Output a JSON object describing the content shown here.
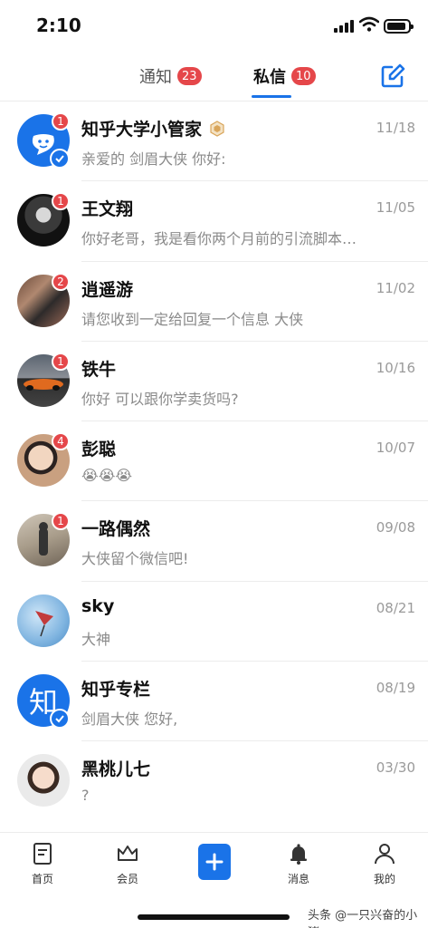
{
  "status_bar": {
    "time": "2:10"
  },
  "tabs": [
    {
      "label": "通知",
      "badge": "23",
      "active": false
    },
    {
      "label": "私信",
      "badge": "10",
      "active": true
    }
  ],
  "colors": {
    "accent": "#1a73e8",
    "badge_red": "#e5474a"
  },
  "messages": [
    {
      "name": "知乎大学小管家",
      "date": "11/18",
      "preview": "亲爱的 剑眉大侠 你好:",
      "unread": "1",
      "verified": true,
      "gold_badge": true,
      "avatar": "zhihu-smile-avatar"
    },
    {
      "name": "王文翔",
      "date": "11/05",
      "preview": "你好老哥，我是看你两个月前的引流脚本…",
      "unread": "1",
      "avatar": "photo-avatar"
    },
    {
      "name": "逍遥游",
      "date": "11/02",
      "preview": "请您收到一定给回复一个信息 大侠",
      "unread": "2",
      "avatar": "photo-avatar"
    },
    {
      "name": "铁牛",
      "date": "10/16",
      "preview": "你好 可以跟你学卖货吗?",
      "unread": "1",
      "avatar": "car-avatar"
    },
    {
      "name": "彭聪",
      "date": "10/07",
      "preview": "😭😭😭",
      "unread": "4",
      "avatar": "photo-avatar"
    },
    {
      "name": "一路偶然",
      "date": "09/08",
      "preview": "大侠留个微信吧!",
      "unread": "1",
      "avatar": "photo-avatar"
    },
    {
      "name": "sky",
      "date": "08/21",
      "preview": "大神",
      "avatar": "sky-avatar"
    },
    {
      "name": "知乎专栏",
      "date": "08/19",
      "preview": "剑眉大侠 您好,",
      "verified": true,
      "avatar_text": "知",
      "avatar": "zhihu-column-avatar"
    },
    {
      "name": "黑桃儿七",
      "date": "03/30",
      "preview": "?",
      "avatar": "photo-avatar"
    }
  ],
  "bottom_nav": [
    {
      "label": "首页",
      "icon": "home-icon"
    },
    {
      "label": "会员",
      "icon": "crown-icon"
    },
    {
      "label": "",
      "icon": "plus-icon"
    },
    {
      "label": "消息",
      "icon": "bell-icon"
    },
    {
      "label": "我的",
      "icon": "person-icon"
    }
  ],
  "watermark": "头条 @一只兴奋的小猪"
}
